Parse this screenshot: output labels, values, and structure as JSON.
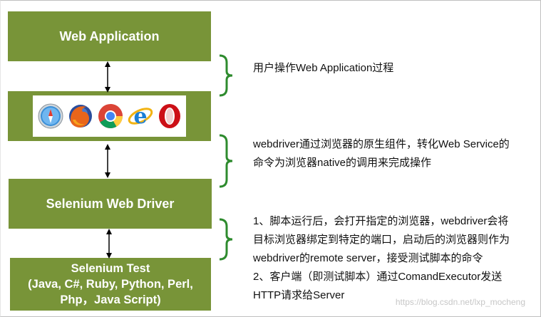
{
  "boxes": {
    "web_application": "Web Application",
    "selenium_web_driver": "Selenium Web Driver",
    "selenium_test_title": "Selenium Test",
    "selenium_test_langs_1": "(Java, C#, Ruby, Python, Perl,",
    "selenium_test_langs_2": "Php，Java Script)"
  },
  "browsers": [
    "safari-icon",
    "firefox-icon",
    "chrome-icon",
    "ie-icon",
    "opera-icon"
  ],
  "notes": {
    "note1": [
      "用户操作Web Application过程"
    ],
    "note2": [
      "webdriver通过浏览器的原生组件，转化Web Service的",
      "命令为浏览器native的调用来完成操作"
    ],
    "note3": [
      "1、脚本运行后，会打开指定的浏览器，webdriver会将",
      "目标浏览器绑定到特定的端口，启动后的浏览器则作为",
      "webdriver的remote server，接受测试脚本的命令",
      "2、客户端（即测试脚本）通过ComandExecutor发送",
      "HTTP请求给Server"
    ]
  },
  "watermark": "https://blog.csdn.net/lxp_mocheng",
  "colors": {
    "box_fill": "#789438",
    "brace": "#2e8b2e",
    "text": "#111111"
  }
}
